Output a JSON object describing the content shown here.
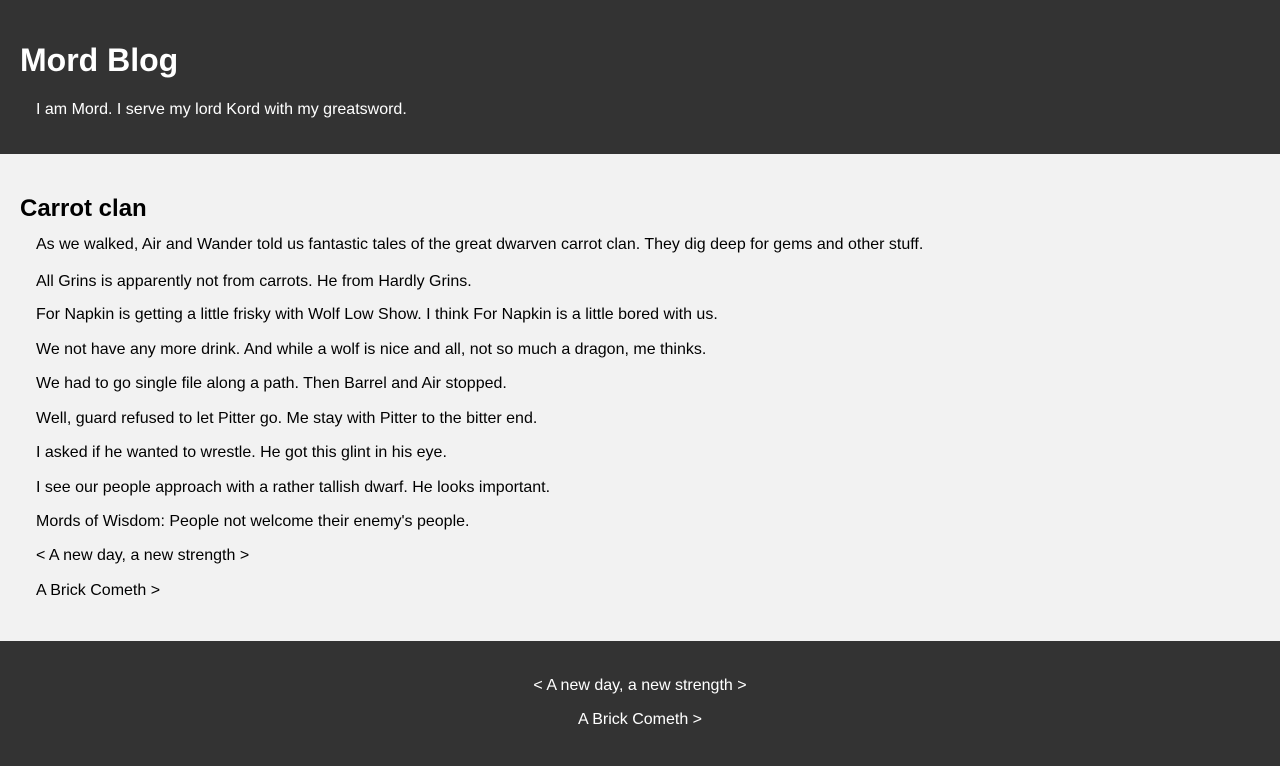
{
  "header": {
    "title": "Mord Blog",
    "tagline": "I am Mord. I serve my lord Kord with my greatsword."
  },
  "post": {
    "title": "Carrot clan",
    "paragraphs": [
      "As we walked, Air and Wander told us fantastic tales of the great dwarven carrot clan. They dig deep for gems and other stuff.",
      "All Grins is apparently not from carrots. He from Hardly Grins.",
      "For Napkin is getting a little frisky with Wolf Low Show. I think For Napkin is a little bored with us.",
      "We not have any more drink. And while a wolf is nice and all, not so much a dragon, me thinks.",
      "We had to go single file along a path. Then Barrel and Air stopped.",
      "Well, guard refused to let Pitter go. Me stay with Pitter to the bitter end.",
      "I asked if he wanted to wrestle. He got this glint in his eye.",
      "I see our people approach with a rather tallish dwarf. He looks important.",
      "Mords of Wisdom: People not welcome their enemy's people."
    ],
    "nav": {
      "prev": "< A new day, a new strength >",
      "next": "A Brick Cometh >"
    }
  },
  "footer": {
    "prev": "< A new day, a new strength >",
    "next": "A Brick Cometh >"
  },
  "colors": {
    "header_bg": "#333333",
    "page_bg": "#f2f2f2",
    "header_text": "#ffffff"
  }
}
